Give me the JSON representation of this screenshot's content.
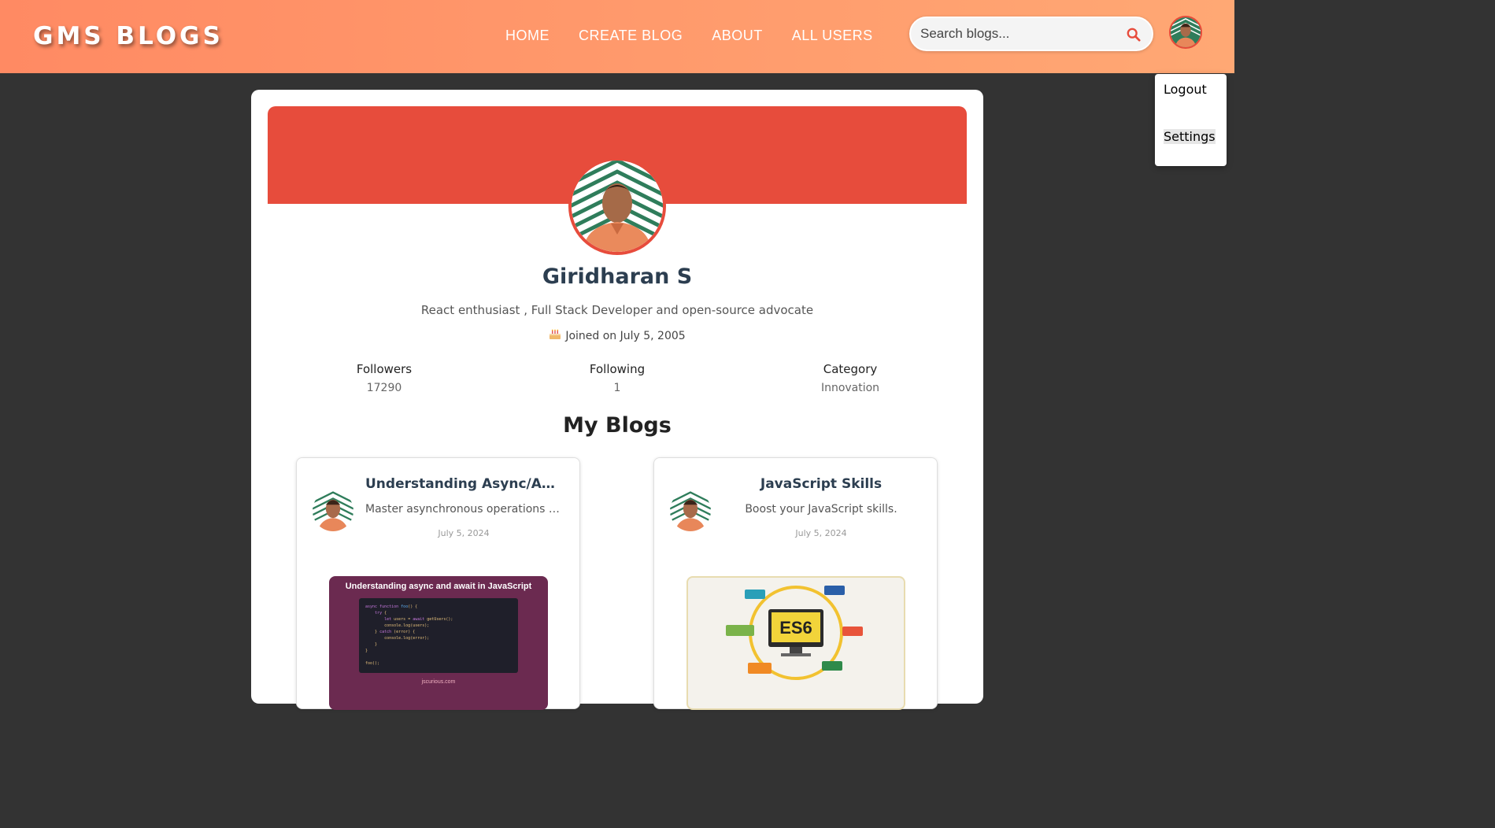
{
  "header": {
    "logo": "GMS BLOGS",
    "nav": [
      "HOME",
      "CREATE BLOG",
      "ABOUT",
      "ALL USERS"
    ],
    "search_placeholder": "Search blogs..."
  },
  "dropdown": {
    "logout": "Logout",
    "settings": "Settings"
  },
  "profile": {
    "name": "Giridharan S",
    "bio": "React enthusiast , Full Stack Developer and open-source advocate",
    "joined": "Joined on July 5, 2005",
    "stats": {
      "followers_label": "Followers",
      "followers_value": "17290",
      "following_label": "Following",
      "following_value": "1",
      "category_label": "Category",
      "category_value": "Innovation"
    }
  },
  "blogs": {
    "heading": "My Blogs",
    "items": [
      {
        "title": "Understanding Async/Await",
        "description": "Master asynchronous operations with async and await",
        "date": "July 5, 2024",
        "thumb_title": "Understanding async and await in JavaScript",
        "thumb_site": "jscurious.com"
      },
      {
        "title": "JavaScript Skills",
        "description": "Boost your JavaScript skills.",
        "date": "July 5, 2024",
        "thumb_title": "ES6"
      }
    ]
  },
  "colors": {
    "header_gradient_start": "#ff8a63",
    "header_gradient_end": "#ffa874",
    "cover": "#e74c3c",
    "page_background": "#333333",
    "name_text": "#2c3e50"
  },
  "icons": [
    "search-icon",
    "cake-icon",
    "avatar"
  ]
}
